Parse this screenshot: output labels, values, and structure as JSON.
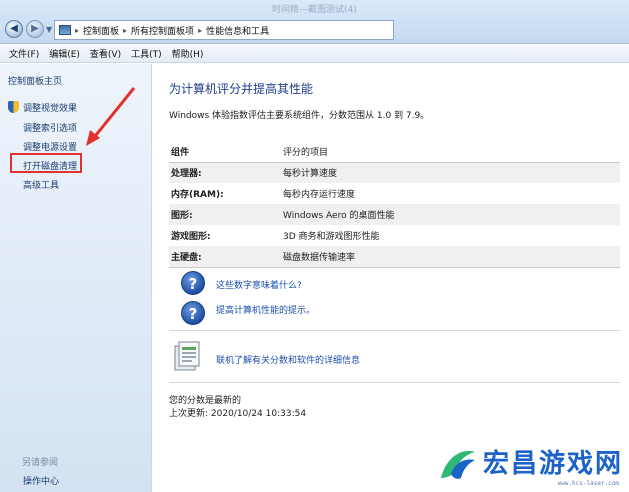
{
  "window": {
    "title_faint": "时间精—截图测试(4)"
  },
  "address": {
    "crumbs": [
      "控制面板",
      "所有控制面板项",
      "性能信息和工具"
    ]
  },
  "menu": [
    "文件(F)",
    "编辑(E)",
    "查看(V)",
    "工具(T)",
    "帮助(H)"
  ],
  "sidebar": {
    "home": "控制面板主页",
    "items": [
      "调整视觉效果",
      "调整索引选项",
      "调整电源设置",
      "打开磁盘清理",
      "高级工具"
    ],
    "see_also": "另请参阅",
    "footer_item": "操作中心"
  },
  "main": {
    "heading": "为计算机评分并提高其性能",
    "description": "Windows 体验指数评估主要系统组件，分数范围从 1.0 到 7.9。",
    "table": {
      "headers": [
        "组件",
        "评分的项目"
      ],
      "rows": [
        [
          "处理器:",
          "每秒计算速度"
        ],
        [
          "内存(RAM):",
          "每秒内存运行速度"
        ],
        [
          "图形:",
          "Windows Aero 的桌面性能"
        ],
        [
          "游戏图形:",
          "3D 商务和游戏图形性能"
        ],
        [
          "主硬盘:",
          "磁盘数据传输速率"
        ]
      ]
    },
    "links": [
      "这些数字意味着什么?",
      "提高计算机性能的提示。",
      "联机了解有关分数和软件的详细信息"
    ],
    "status_line1": "您的分数是最新的",
    "status_line2": "上次更新: 2020/10/24 10:33:54"
  },
  "watermark": {
    "text": "宏昌游戏网",
    "url": "www.hcs-laser.com"
  },
  "colors": {
    "link": "#1a4fae",
    "heading": "#1e3d8f",
    "highlight": "#e0332f"
  }
}
